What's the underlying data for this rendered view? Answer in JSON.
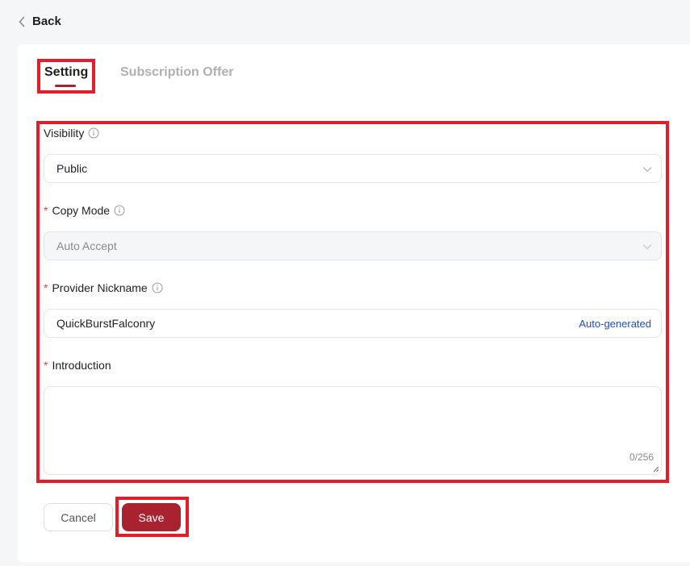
{
  "header": {
    "back_label": "Back"
  },
  "tabs": [
    {
      "label": "Setting",
      "active": true
    },
    {
      "label": "Subscription Offer",
      "active": false
    }
  ],
  "form": {
    "visibility": {
      "label": "Visibility",
      "value": "Public"
    },
    "copy_mode": {
      "label": "Copy Mode",
      "value": "Auto Accept",
      "required": true,
      "disabled": true
    },
    "provider_nickname": {
      "label": "Provider Nickname",
      "value": "QuickBurstFalconry",
      "required": true,
      "action_label": "Auto-generated"
    },
    "introduction": {
      "label": "Introduction",
      "value": "",
      "required": true,
      "counter": "0/256"
    },
    "required_mark": "*"
  },
  "actions": {
    "cancel_label": "Cancel",
    "save_label": "Save"
  },
  "colors": {
    "accent": "#a8222f",
    "highlight": "#e51c2a",
    "link": "#1e4fb5",
    "required": "#e5484d"
  },
  "icons": [
    "chevron-left-icon",
    "info-icon",
    "chevron-down-icon"
  ]
}
